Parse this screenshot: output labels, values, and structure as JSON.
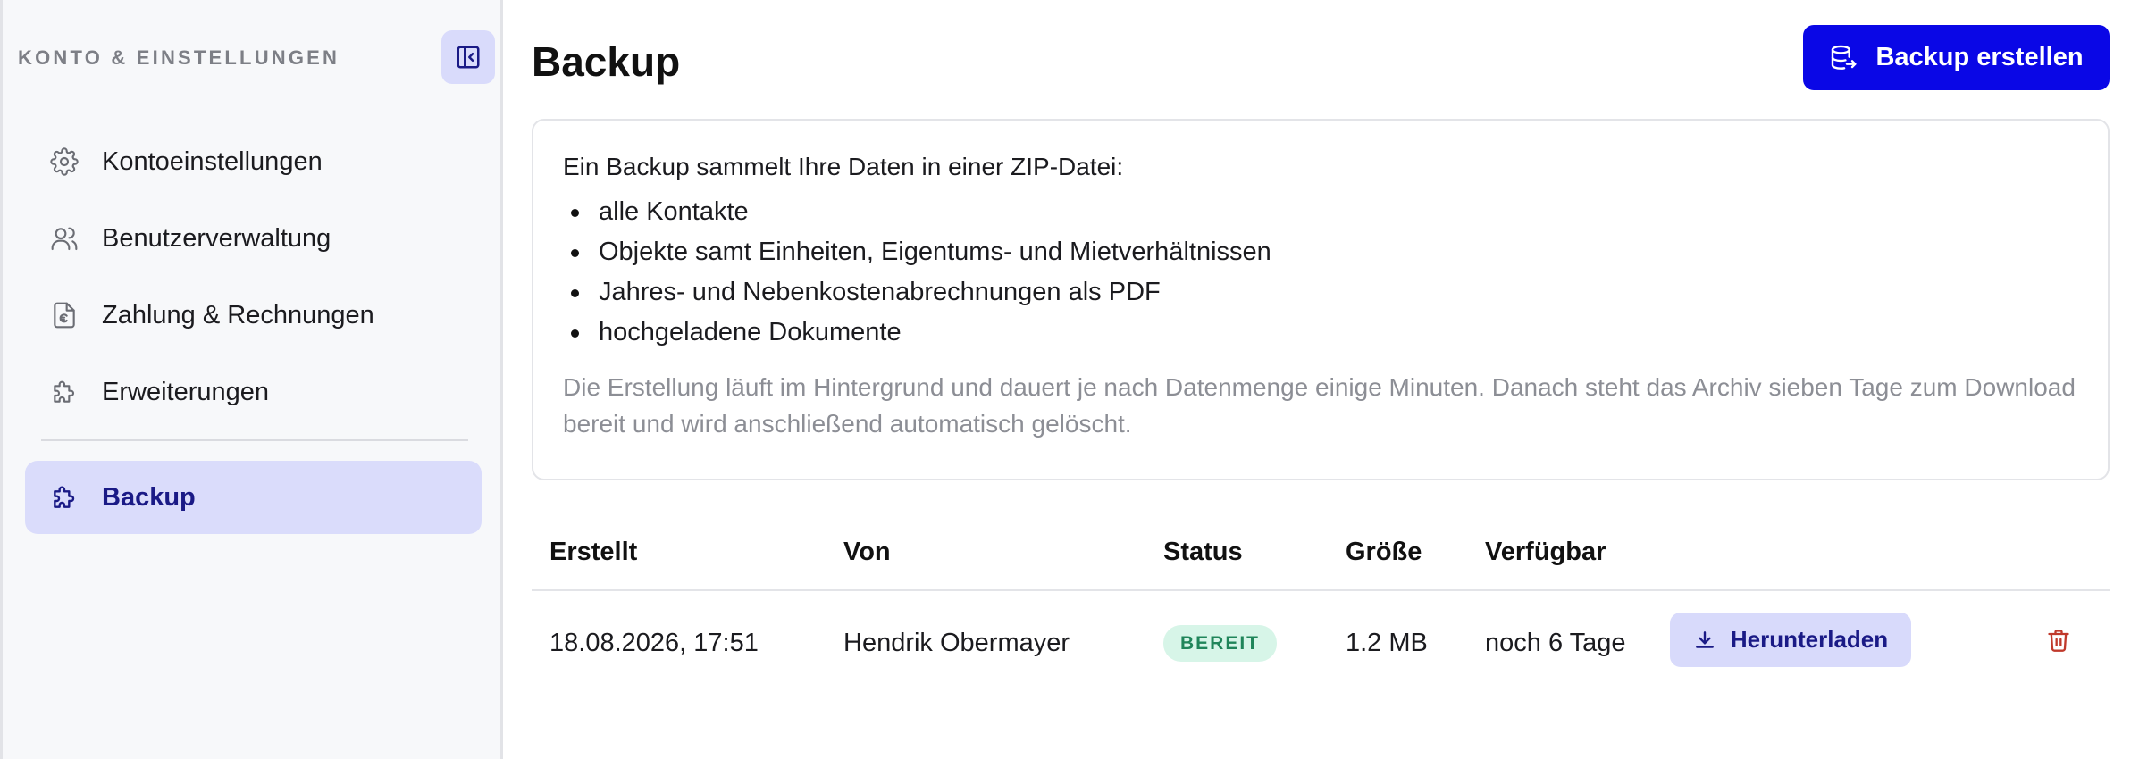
{
  "sidebar": {
    "title": "KONTO & EINSTELLUNGEN",
    "collapse_icon": "sidebar-collapse-icon",
    "items": [
      {
        "label": "Kontoeinstellungen",
        "icon": "gear-icon"
      },
      {
        "label": "Benutzerverwaltung",
        "icon": "users-icon"
      },
      {
        "label": "Zahlung & Rechnungen",
        "icon": "euro-document-icon"
      },
      {
        "label": "Erweiterungen",
        "icon": "puzzle-icon"
      }
    ],
    "active_item": {
      "label": "Backup",
      "icon": "puzzle-icon"
    }
  },
  "header": {
    "title": "Backup",
    "create_button_label": "Backup erstellen",
    "create_button_icon": "database-export-icon"
  },
  "info": {
    "intro": "Ein Backup sammelt Ihre Daten in einer ZIP-Datei:",
    "items": [
      "alle Kontakte",
      "Objekte samt Einheiten, Eigentums- und Mietverhältnissen",
      "Jahres- und Nebenkostenabrechnungen als PDF",
      "hochgeladene Dokumente"
    ],
    "note": "Die Erstellung läuft im Hintergrund und dauert je nach Datenmenge einige Minuten. Danach steht das Archiv sieben Tage zum Download bereit und wird anschließend automatisch gelöscht."
  },
  "table": {
    "columns": [
      "Erstellt",
      "Von",
      "Status",
      "Größe",
      "Verfügbar"
    ],
    "rows": [
      {
        "created": "18.08.2026, 17:51",
        "by": "Hendrik Obermayer",
        "status": "BEREIT",
        "size": "1.2 MB",
        "available": "noch 6 Tage",
        "download_label": "Herunterladen"
      }
    ]
  },
  "colors": {
    "accent": "#0a07e6",
    "active_bg": "#dadcfb",
    "status_ready_bg": "#d7f5e8",
    "status_ready_text": "#20855a",
    "delete": "#c0392b"
  }
}
